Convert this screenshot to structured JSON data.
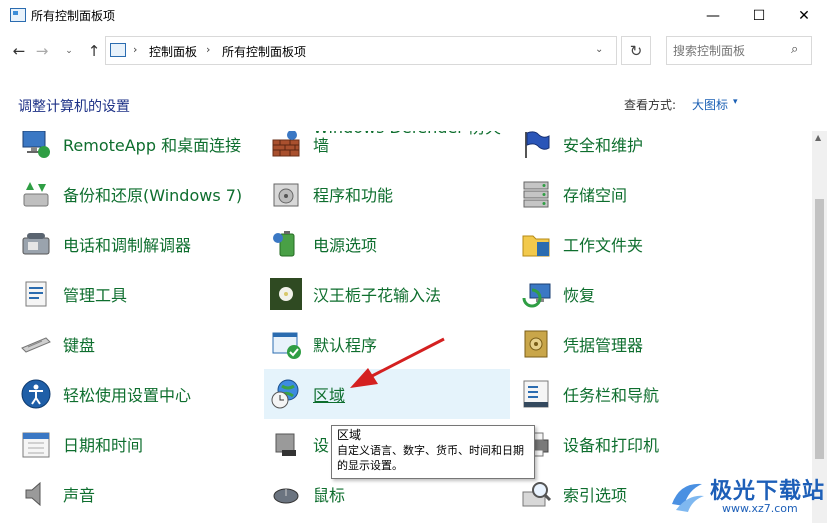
{
  "window": {
    "title": "所有控制面板项",
    "controls": {
      "minimize": "—",
      "maximize": "☐",
      "close": "✕"
    }
  },
  "nav": {
    "back": "←",
    "forward": "→",
    "recent": "⌄",
    "up": "↑",
    "sep": "›",
    "breadcrumbs": [
      "控制面板",
      "所有控制面板项"
    ],
    "dropdown": "⌄",
    "refresh": "↻"
  },
  "search": {
    "placeholder": "搜索控制面板",
    "icon": "⌕"
  },
  "header": {
    "title": "调整计算机的设置",
    "view_by_label": "查看方式:",
    "view_by_value": "大图标",
    "view_dropdown": "▾"
  },
  "items": {
    "col1": [
      "RemoteApp 和桌面连接",
      "备份和还原(Windows 7)",
      "电话和调制解调器",
      "管理工具",
      "键盘",
      "轻松使用设置中心",
      "日期和时间",
      "声音"
    ],
    "col2": [
      "Windows Defender 防火墙",
      "程序和功能",
      "电源选项",
      "汉王栀子花输入法",
      "默认程序",
      "区域",
      "设",
      "鼠标"
    ],
    "col3": [
      "安全和维护",
      "存储空间",
      "工作文件夹",
      "恢复",
      "凭据管理器",
      "任务栏和导航",
      "设备和打印机",
      "索引选项"
    ]
  },
  "tooltip": {
    "title": "区域",
    "body": "自定义语言、数字、货币、时间和日期的显示设置。"
  },
  "scrollbar": {
    "up": "▲"
  },
  "watermark": {
    "text": "极光下载站",
    "url": "www.xz7.com"
  },
  "colors": {
    "link_green": "#0e6e2e",
    "heading_blue": "#1e3287",
    "highlight": "#e5f3fb",
    "arrow_red": "#d42020"
  }
}
